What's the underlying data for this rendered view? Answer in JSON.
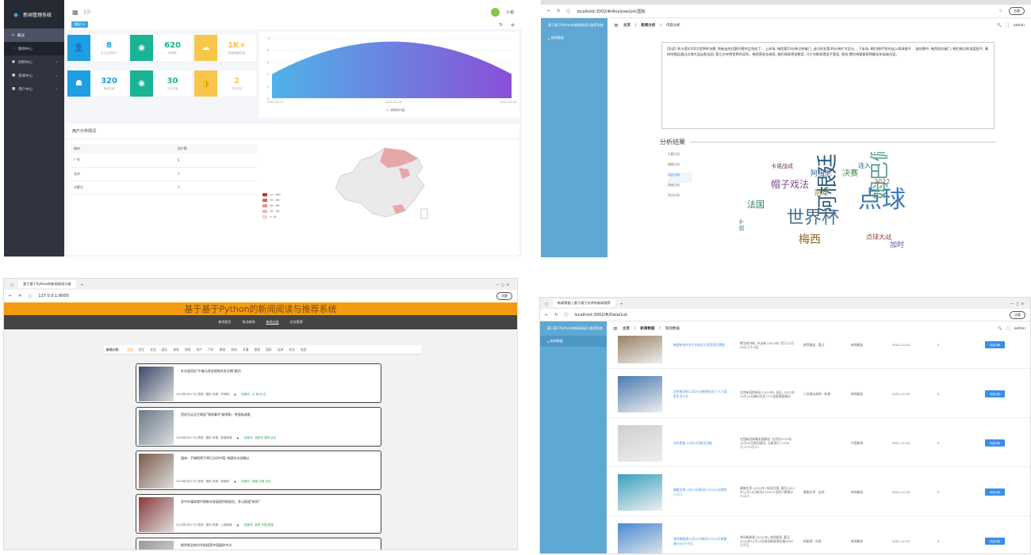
{
  "q1": {
    "app_title": "新闻管理系统",
    "breadcrumb": "主页",
    "user": "小裕",
    "tab_active": "概况",
    "menu": [
      {
        "label": "概况",
        "active": true
      },
      {
        "label": "新闻中心",
        "sub": true
      },
      {
        "label": "控制中心"
      },
      {
        "label": "新闻中心"
      },
      {
        "label": "用户中心"
      }
    ],
    "stats_row1": [
      {
        "value": "8",
        "label": "今日注册用户",
        "color": "#1e9fe2",
        "icon": "user-add-icon"
      },
      {
        "value": "620",
        "label": "新闻数",
        "color": "#1ab394",
        "icon": "eye-icon"
      },
      {
        "value": "1K+",
        "label": "新闻收藏总量",
        "color": "#f8c64a",
        "icon": "cloud-icon"
      }
    ],
    "stats_row2": [
      {
        "value": "320",
        "label": "新增注册",
        "color": "#1e9fe2",
        "icon": "users-icon"
      },
      {
        "value": "30",
        "label": "今日访客",
        "color": "#1ab394",
        "icon": "eye-icon"
      },
      {
        "value": "2",
        "label": "今日评论",
        "color": "#f8c64a",
        "icon": "thumbs-up-icon"
      }
    ],
    "chart_legend": "新闻访问量",
    "chart_data": {
      "type": "area",
      "x": [
        "2021-04-13",
        "2021-04-16",
        "2021-05-18"
      ],
      "series": [
        {
          "name": "新闻访问量",
          "values": [
            4,
            9.4,
            4
          ]
        }
      ],
      "ylim": [
        0,
        10
      ],
      "yticks": [
        "10",
        "8",
        "6",
        "4",
        "2",
        "0"
      ]
    },
    "user_section_title": "用户分布情况",
    "table_headers": [
      "城市",
      "用户数"
    ],
    "table_rows": [
      [
        "广东",
        "5"
      ],
      [
        "北京",
        "1"
      ],
      [
        "内蒙古",
        "1"
      ]
    ],
    "map_legend": [
      ">= 100",
      "70 - 99",
      "50 - 69",
      "10 - 49",
      "< 10"
    ],
    "map_legend_colors": [
      "#c23531",
      "#d66561",
      "#e39390",
      "#eeb8b6",
      "#f3d0cf"
    ]
  },
  "q2": {
    "url": "localhost:3002/#/Analyse/List/国际",
    "breadcrumb": [
      "主页",
      "新闻分析",
      "内容分析"
    ],
    "user": "admin",
    "sidebar_title": "基于基于Python的新闻阅读与推荐系统",
    "sidebar_items": [
      "新闻数据"
    ],
    "article_text": "[导读] 到卡塔尔2022世界杯决赛, 到新出的比赛开赛并且完成了... 上半场, 梅西第23分钟点射破门, 迪马利亚第36分钟扩大比分... 下半场, 姆巴佩97秒内连入两球扳平... 加时赛中, 梅西再次破门, 姆巴佩点射再度扳平, 最终阿根廷通过点球大战击败法国, 第三次夺得世界杯冠军。梅西荣获金球奖, 姆巴佩获得金靴奖, 马丁内斯获得金手套奖, 恩佐·费尔南德斯获得最佳年轻球员奖。",
    "section_title": "分析结果",
    "analysis_tabs": [
      "主题分析",
      "情感分析",
      "词云分析",
      "情绪分析",
      "热词分析"
    ],
    "active_tab": 2,
    "wordcloud": [
      {
        "w": "阿根廷",
        "size": 26,
        "color": "#2d5a7b"
      },
      {
        "w": "点球",
        "size": 30,
        "color": "#3a7bbf"
      },
      {
        "w": "世界杯",
        "size": 22,
        "color": "#4a6b8c"
      },
      {
        "w": "姆巴佩",
        "size": 24,
        "color": "#5aa08a"
      },
      {
        "w": "帽子戏法",
        "size": 12,
        "color": "#7a4a8a"
      },
      {
        "w": "阿梅尼",
        "size": 9,
        "color": "#3a5a9a"
      },
      {
        "w": "决赛",
        "size": 10,
        "color": "#4a8a4a"
      },
      {
        "w": "连入",
        "size": 8,
        "color": "#2a6a9a"
      },
      {
        "w": "卡诺战成",
        "size": 7,
        "color": "#6a3a5a"
      },
      {
        "w": "梅西",
        "size": 14,
        "color": "#8a6a2a"
      },
      {
        "w": "点球大战",
        "size": 8,
        "color": "#9a3a3a"
      },
      {
        "w": "扳平",
        "size": 8,
        "color": "#3a8a9a"
      },
      {
        "w": "加时",
        "size": 9,
        "color": "#5a5a9a"
      },
      {
        "w": "法国",
        "size": 11,
        "color": "#2a7a6a"
      },
      {
        "w": "冠军",
        "size": 9,
        "color": "#7a7a2a"
      },
      {
        "w": "2022",
        "size": 8,
        "color": "#aa5a3a"
      }
    ]
  },
  "q3": {
    "tab_title": "基于基于Python的新闻阅读与推",
    "url": "127.0.0.1:8000",
    "site_title": "基于基于Python的新闻阅读与推荐系统",
    "nav": [
      "新闻首页",
      "热点新闻",
      "新闻分类",
      "后台管理"
    ],
    "category_label": "新闻分类：",
    "categories": [
      "全部",
      "民生",
      "文化",
      "娱乐",
      "体育",
      "财经",
      "房产",
      "汽车",
      "教育",
      "科技",
      "军事",
      "旅游",
      "国际",
      "证券",
      "农业",
      "电竞"
    ],
    "news": [
      {
        "title": "外交部回应\"中美元首会晤联合发言稿\"疑问",
        "meta": "2024年5月17日  类别：国际  来源：环球网",
        "kw": "关键词：中 美 回 应"
      },
      {
        "title": "西班牙足总主席因\"强吻事件\"被停职，将面临调查",
        "meta": "2024年5月17日  类别：国际  来源：新浪新闻",
        "kw": "关键词：西班牙 强吻 足总"
      },
      {
        "title": "媒体：尹锡悦将于明日访问中国, 韩国外交部确认",
        "meta": "2024年5月17日  类别：国际  来源：新浪网",
        "kw": "关键词：韩国 中国 访问"
      },
      {
        "title": "多中外媒体就中国新年发展提供新报告、多元报道\"新质\"",
        "meta": "2024年5月17日  类别：国内  来源：上观新闻",
        "kw": "关键词：新质 中国 报道"
      },
      {
        "title": "俄罗斯总统访华前接受中国媒体专访",
        "meta": "",
        "kw": ""
      }
    ]
  },
  "q4": {
    "tab_title": "新闻数据 | 基于基于技术的新闻推荐",
    "url": "localhost:3002/#/Data/List",
    "breadcrumb": [
      "主页",
      "新闻数据",
      "新闻数据"
    ],
    "user": "admin",
    "sidebar_title": "基于基于Python的新闻阅读与推荐系统",
    "sidebar_items": [
      "新闻数据"
    ],
    "rows": [
      {
        "title": "韩国知名外资千亿商业大项目签约落地",
        "desc": "数字经济新, 冲击新 (2022年) 签订12月20日上午小区",
        "tags": "推荐精选 · 重点",
        "src": "新闻精选",
        "date": "2022-12-20",
        "n": "0",
        "btn": "内容分析"
      },
      {
        "title": "北京新冠的12月19日新增社区77人人居家生活人员",
        "desc": "北京新冠的新冠 (2022年) 社区, 2022年12月19日确诊社区77人居家隔离情况",
        "tags": "人员确诊病例 · 新增",
        "src": "新闻精选",
        "date": "2022-12-20",
        "n": "0",
        "btn": "内容分析"
      },
      {
        "title": "北京提倡 12月20日新冠日报",
        "desc": "全国新冠病毒发展情况, 北京在2022年12月20日新冠情况, 当前进行 (1100万-1770万人)",
        "tags": "",
        "src": "中国新闻",
        "date": "2022-12-20",
        "n": "0",
        "btn": "内容分析"
      },
      {
        "title": "康复比率12月19日新冠17070人出院的72万人",
        "desc": "康复比率 (2022年) 新冠日报, 截至2022年12月19日新冠17070人出院人数累计72万人",
        "tags": "康复比率 · 出院",
        "src": "新闻精选",
        "date": "2022-12-20",
        "n": "0",
        "btn": "内容分析"
      },
      {
        "title": "海洋新能源12月19日新冠17070万新能源4000万千瓦",
        "desc": "海洋新能源 (2022年) 海洋能源, 截至2022年12月19日新冠新能源总量4000万千瓦",
        "tags": "新能源 · 风电",
        "src": "新闻精选",
        "date": "2022-12-20",
        "n": "0",
        "btn": "内容分析"
      }
    ]
  }
}
